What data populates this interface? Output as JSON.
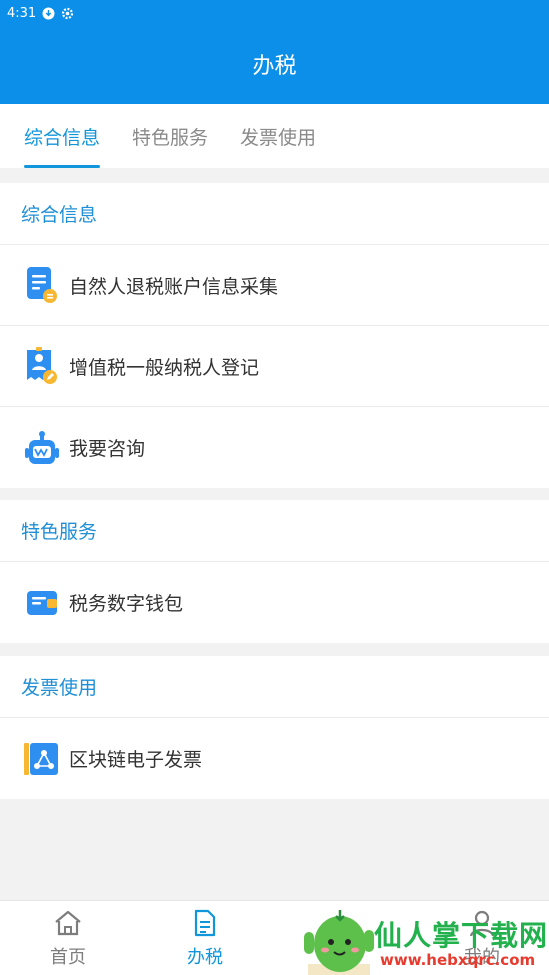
{
  "status_bar": {
    "time": "4:31"
  },
  "header": {
    "title": "办税"
  },
  "tabs": [
    {
      "label": "综合信息",
      "active": true
    },
    {
      "label": "特色服务",
      "active": false
    },
    {
      "label": "发票使用",
      "active": false
    }
  ],
  "sections": [
    {
      "title": "综合信息",
      "items": [
        {
          "label": "自然人退税账户信息采集",
          "icon": "document-coin-icon"
        },
        {
          "label": "增值税一般纳税人登记",
          "icon": "id-badge-pen-icon"
        },
        {
          "label": "我要咨询",
          "icon": "robot-icon"
        }
      ]
    },
    {
      "title": "特色服务",
      "items": [
        {
          "label": "税务数字钱包",
          "icon": "wallet-icon"
        }
      ]
    },
    {
      "title": "发票使用",
      "items": [
        {
          "label": "区块链电子发票",
          "icon": "blockchain-invoice-icon"
        }
      ]
    }
  ],
  "bottom_nav": [
    {
      "label": "首页",
      "icon": "home-icon",
      "active": false
    },
    {
      "label": "办税",
      "icon": "document-icon",
      "active": true
    },
    {
      "label": "我的",
      "icon": "user-icon",
      "active": false
    }
  ],
  "watermark": {
    "text": "仙人掌下载网",
    "url": "www.hebxqrc.com"
  },
  "colors": {
    "primary": "#0b8fe8",
    "accent": "#1296db",
    "background": "#f2f2f2"
  }
}
